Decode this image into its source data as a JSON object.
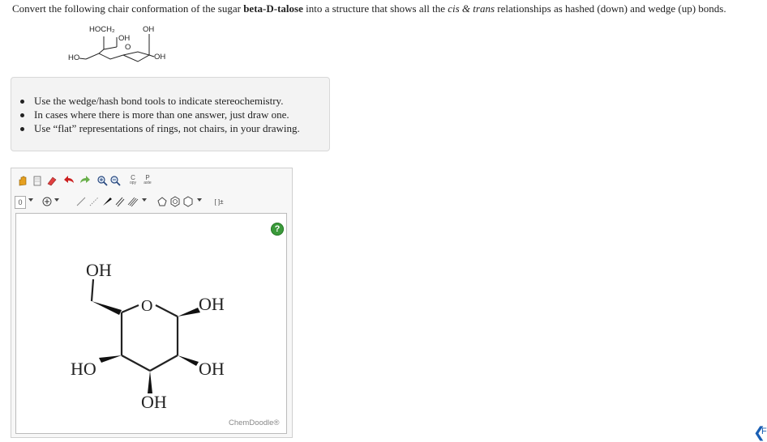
{
  "question": {
    "prefix": "Convert the following chair conformation of the sugar ",
    "sugar_name": "beta-D-talose",
    "middle": " into a structure that shows all the ",
    "cis_trans": "cis & trans",
    "suffix": " relationships as hashed (down) and wedge (up) bonds."
  },
  "chair_labels": {
    "hoch2": "HOCH₂",
    "oh_top_right": "OH",
    "oh_top_mid": "OH",
    "ring_o": "O",
    "ho_left": "HO",
    "oh_right": "OH"
  },
  "instructions": [
    "Use the wedge/hash bond tools to indicate stereochemistry.",
    "In cases where there is more than one answer, just draw one.",
    "Use “flat” representations of rings, not chairs, in your drawing."
  ],
  "toolbar": {
    "copy_label_top": "C",
    "copy_label_bottom": "opy",
    "paste_label_top": "P",
    "paste_label_bottom": "aste",
    "charge_label": "0",
    "label_tool": "[ ]±"
  },
  "drawing": {
    "atoms": {
      "oh_ch2": "OH",
      "ring_o": "O",
      "oh_c1": "OH",
      "oh_c2": "OH",
      "ho_c4": "HO",
      "oh_c3": "OH"
    },
    "help_label": "?",
    "brand": "ChemDoodle®"
  },
  "colors": {
    "help_green": "#3a9a3a",
    "nav_arrow": "#1a5fb4"
  },
  "nav": {
    "arrow": "❮",
    "letter": "F"
  }
}
